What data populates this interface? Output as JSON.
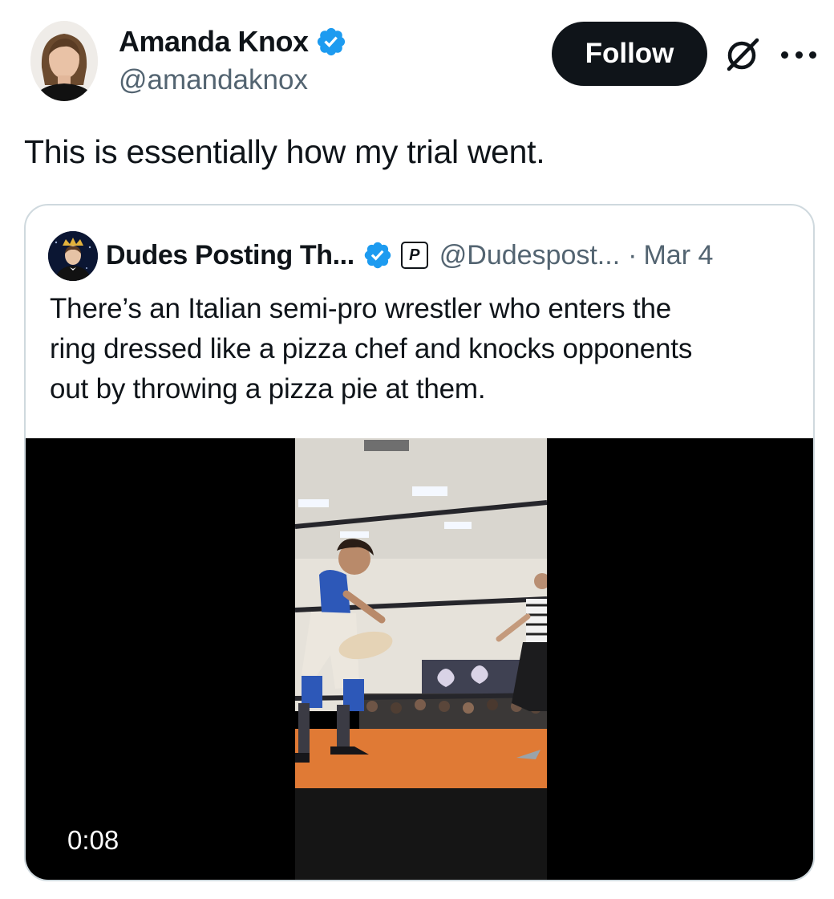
{
  "author": {
    "display_name": "Amanda Knox",
    "handle": "@amandaknox",
    "verified": true
  },
  "actions": {
    "follow_label": "Follow",
    "grok_icon": "grok-icon",
    "more_icon": "more-icon"
  },
  "tweet": {
    "text": "This is essentially how my trial went."
  },
  "quoted": {
    "display_name": "Dudes Posting Th...",
    "verified": true,
    "affiliate_badge": "P",
    "handle": "@Dudespost...",
    "separator": "·",
    "date": "Mar 4",
    "text_lines": [
      "There’s an Italian semi-pro wrestler who enters the",
      "ring dressed like a pizza chef and knocks opponents",
      "out by throwing a pizza pie at them."
    ],
    "video": {
      "duration": "0:08"
    }
  },
  "colors": {
    "text_primary": "#0f1419",
    "text_secondary": "#536471",
    "verified_blue": "#1d9bf0",
    "border": "#cfd9de",
    "follow_bg": "#0f1419"
  }
}
